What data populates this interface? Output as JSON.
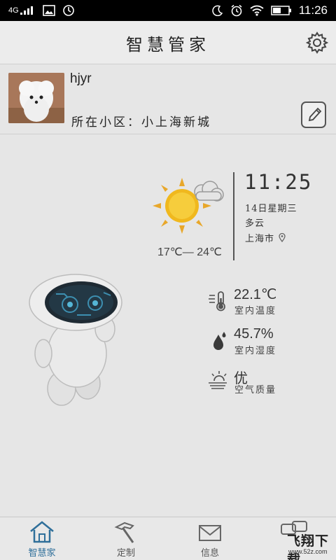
{
  "status_bar": {
    "network": "4G",
    "time": "11:26"
  },
  "header": {
    "title": "智慧管家"
  },
  "profile": {
    "username": "hjyr",
    "community_label": "所在小区：",
    "community_name": "小上海新城"
  },
  "weather": {
    "temp_range": "17℃— 24℃",
    "time": "11:25",
    "date": "14日星期三",
    "condition": "多云",
    "city": "上海市"
  },
  "indoor": {
    "temperature": {
      "value": "22.1℃",
      "label": "室内温度"
    },
    "humidity": {
      "value": "45.7%",
      "label": "室内湿度"
    },
    "air_quality": {
      "value": "优",
      "label": "空气质量"
    }
  },
  "nav": {
    "items": [
      {
        "label": "智慧家",
        "icon": "house-icon",
        "active": true
      },
      {
        "label": "定制",
        "icon": "hammer-icon"
      },
      {
        "label": "信息",
        "icon": "mail-icon"
      },
      {
        "label": "",
        "icon": "chat-icon"
      }
    ]
  },
  "watermark": {
    "text": "飞翔下载",
    "sub": "www.52z.com"
  },
  "colors": {
    "active_nav": "#2f6f9a",
    "status_bar": "#000000",
    "background": "#e6e6e6"
  }
}
